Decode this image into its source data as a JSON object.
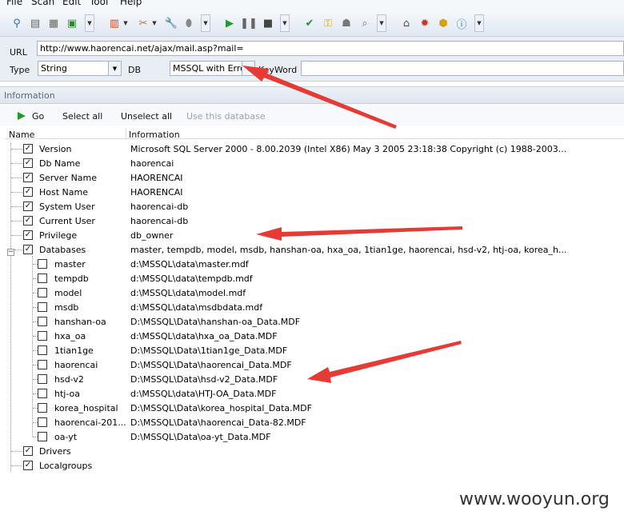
{
  "menu": {
    "file": "File",
    "scan": "Scan",
    "edit": "Edit",
    "tool": "Tool",
    "help": "Help"
  },
  "url": {
    "label": "URL",
    "value": "http://www.haorencai.net/ajax/mail.asp?mail="
  },
  "type": {
    "label": "Type",
    "value": "String"
  },
  "db": {
    "label": "DB",
    "value": "MSSQL with Error"
  },
  "keyword": {
    "label": "KeyWord",
    "value": ""
  },
  "info_section": {
    "title": "Information"
  },
  "actions": {
    "go": "Go",
    "select_all": "Select all",
    "unselect_all": "Unselect all",
    "use_db": "Use this database"
  },
  "columns": {
    "name": "Name",
    "information": "Information"
  },
  "rows": [
    {
      "name": "Version",
      "info": "Microsoft SQL Server  2000 - 8.00.2039 (Intel X86) May  3 2005 23:18:38 Copyright (c) 1988-2003...",
      "checked": true
    },
    {
      "name": "Db Name",
      "info": "haorencai",
      "checked": true
    },
    {
      "name": "Server Name",
      "info": "HAORENCAI",
      "checked": true
    },
    {
      "name": "Host Name",
      "info": "HAORENCAI",
      "checked": true
    },
    {
      "name": "System User",
      "info": "haorencai-db",
      "checked": true
    },
    {
      "name": "Current User",
      "info": "haorencai-db",
      "checked": true
    },
    {
      "name": "Privilege",
      "info": "db_owner",
      "checked": true
    },
    {
      "name": "Databases",
      "info": "master, tempdb, model, msdb, hanshan-oa, hxa_oa, 1tian1ge, haorencai, hsd-v2, htj-oa, korea_h...",
      "checked": true
    }
  ],
  "databases": [
    {
      "name": "master",
      "info": "d:\\MSSQL\\data\\master.mdf"
    },
    {
      "name": "tempdb",
      "info": "d:\\MSSQL\\data\\tempdb.mdf"
    },
    {
      "name": "model",
      "info": "d:\\MSSQL\\data\\model.mdf"
    },
    {
      "name": "msdb",
      "info": "d:\\MSSQL\\data\\msdbdata.mdf"
    },
    {
      "name": "hanshan-oa",
      "info": "D:\\MSSQL\\Data\\hanshan-oa_Data.MDF"
    },
    {
      "name": "hxa_oa",
      "info": "d:\\MSSQL\\data\\hxa_oa_Data.MDF"
    },
    {
      "name": "1tian1ge",
      "info": "D:\\MSSQL\\Data\\1tian1ge_Data.MDF"
    },
    {
      "name": "haorencai",
      "info": "D:\\MSSQL\\Data\\haorencai_Data.MDF"
    },
    {
      "name": "hsd-v2",
      "info": "D:\\MSSQL\\Data\\hsd-v2_Data.MDF"
    },
    {
      "name": "htj-oa",
      "info": "d:\\MSSQL\\data\\HTJ-OA_Data.MDF"
    },
    {
      "name": "korea_hospital",
      "info": "D:\\MSSQL\\Data\\korea_hospital_Data.MDF"
    },
    {
      "name": "haorencai-201...",
      "info": "D:\\MSSQL\\Data\\haorencai_Data-82.MDF"
    },
    {
      "name": "oa-yt",
      "info": "D:\\MSSQL\\Data\\oa-yt_Data.MDF"
    }
  ],
  "tail_rows": [
    {
      "name": "Drivers",
      "checked": true
    },
    {
      "name": "Localgroups",
      "checked": true
    }
  ],
  "watermark": "www.wooyun.org",
  "colors": {
    "arrow": "#e63b35",
    "check": "#111111",
    "go_icon": "#1e9a2a"
  }
}
